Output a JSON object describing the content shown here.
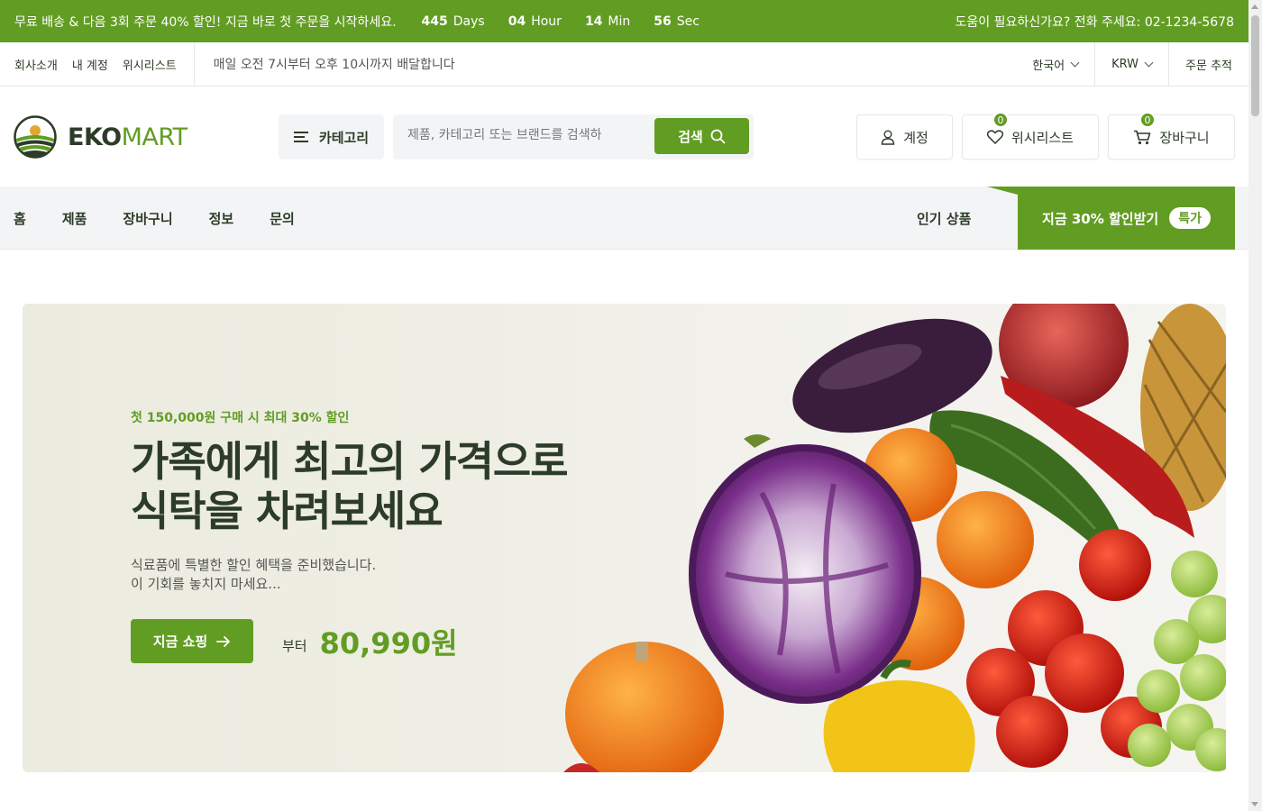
{
  "topbar": {
    "promo": "무료 배송 & 다음 3회 주문 40% 할인! 지금 바로 첫 주문을 시작하세요.",
    "countdown": [
      {
        "value": "445",
        "unit": "Days"
      },
      {
        "value": "04",
        "unit": "Hour"
      },
      {
        "value": "14",
        "unit": "Min"
      },
      {
        "value": "56",
        "unit": "Sec"
      }
    ],
    "help": "도움이 필요하신가요? 전화 주세요: 02-1234-5678"
  },
  "subbar": {
    "links": [
      "회사소개",
      "내 계정",
      "위시리스트"
    ],
    "note": "매일 오전 7시부터 오후 10시까지 배달합니다",
    "language": "한국어",
    "currency": "KRW",
    "track_order": "주문 추적"
  },
  "header": {
    "logo_bold": "EKO",
    "logo_light": "MART",
    "category_label": "카테고리",
    "search_placeholder": "제품, 카테고리 또는 브랜드를 검색하",
    "search_button": "검색",
    "account_label": "계정",
    "wishlist_label": "위시리스트",
    "wishlist_count": "0",
    "cart_label": "장바구니",
    "cart_count": "0"
  },
  "nav": {
    "items": [
      "홈",
      "제품",
      "장바구니",
      "정보",
      "문의"
    ],
    "trending": "인기 상품",
    "deal_label": "지금 30% 할인받기",
    "deal_pill": "특가"
  },
  "hero": {
    "subtitle": "첫 150,000원 구매 시 최대 30% 할인",
    "title_line1": "가족에게 최고의 가격으로",
    "title_line2": "식탁을 차려보세요",
    "desc_line1": "식료품에 특별한 할인 혜택을 준비했습니다.",
    "desc_line2": "이 기회를 놓치지 마세요...",
    "shop_button": "지금 쇼핑",
    "from_label": "부터",
    "price": "80,990원"
  },
  "colors": {
    "brand": "#629d23",
    "text": "#2c3c28",
    "nav_bg": "#f3f4f6"
  }
}
